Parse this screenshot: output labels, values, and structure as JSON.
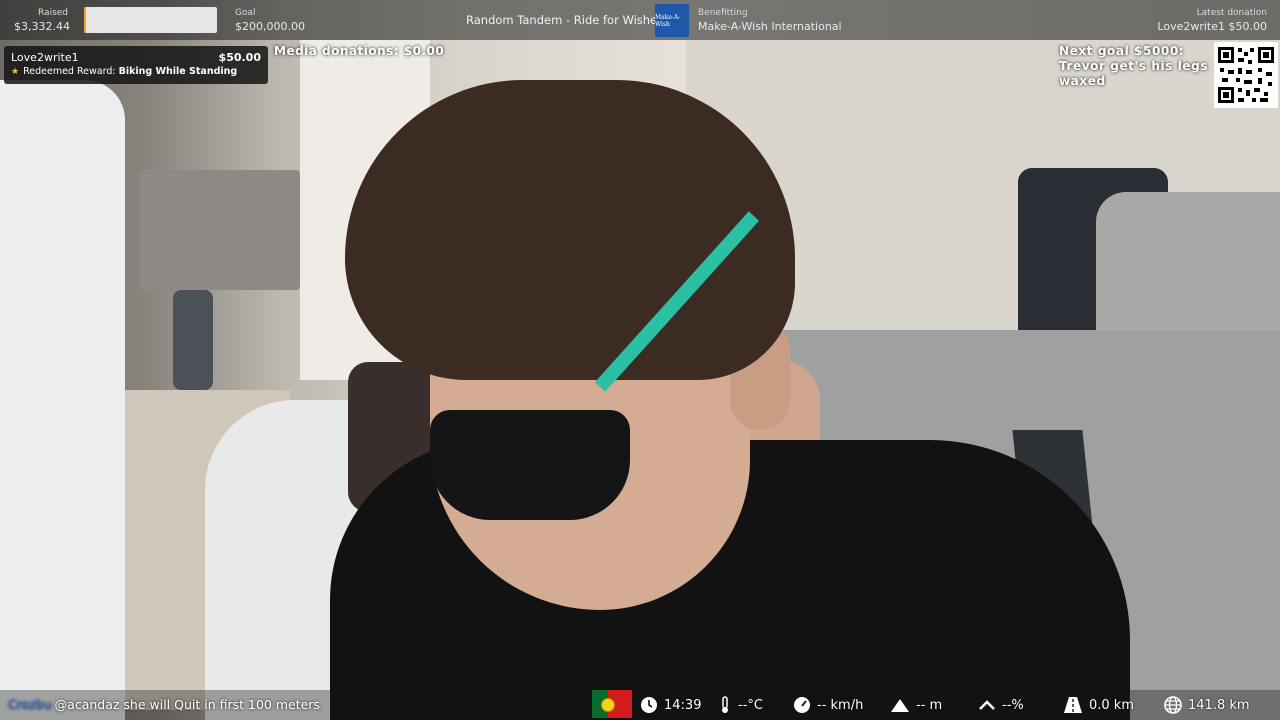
{
  "top_bar": {
    "raised_label": "Raised",
    "raised_value": "$3,332.44",
    "goal_label": "Goal",
    "goal_value": "$200,000.00",
    "progress_fraction": 0.0167,
    "campaign_title": "Random Tandem - Ride for Wishes",
    "benefitting_label": "Benefitting",
    "beneficiary": "Make-A-Wish International",
    "logo_text": "Make-A-Wish",
    "latest_donation_label": "Latest donation",
    "latest_donation_value": "Love2write1 $50.00"
  },
  "alert": {
    "donor": "Love2write1",
    "amount": "$50.00",
    "reward_prefix": "Redeemed Reward:",
    "reward_name": "Biking While Standing"
  },
  "media_donations": "Media donations: $0.00",
  "next_goal": {
    "line1": "Next goal $5000:",
    "line2": "Trevor get's his legs",
    "line3": "waxed"
  },
  "chat": {
    "username": "Crozbu",
    "message": "@acandaz she will Quit in first 100 meters"
  },
  "stats": {
    "time": "14:39",
    "temperature": "--°C",
    "speed": "-- km/h",
    "altitude": "-- m",
    "grade": "--%",
    "distance_today": "0.0 km",
    "distance_total": "141.8 km"
  },
  "icons": [
    "star-icon",
    "clock-icon",
    "thermometer-icon",
    "speedometer-icon",
    "mountain-icon",
    "incline-icon",
    "road-icon",
    "globe-icon"
  ],
  "colors": {
    "progress_fill": "#f5a623",
    "chat_username": "#3b7bd9",
    "logo_blue": "#1f58a8",
    "flag_green": "#0a6b2e",
    "flag_red": "#d21b1b"
  }
}
